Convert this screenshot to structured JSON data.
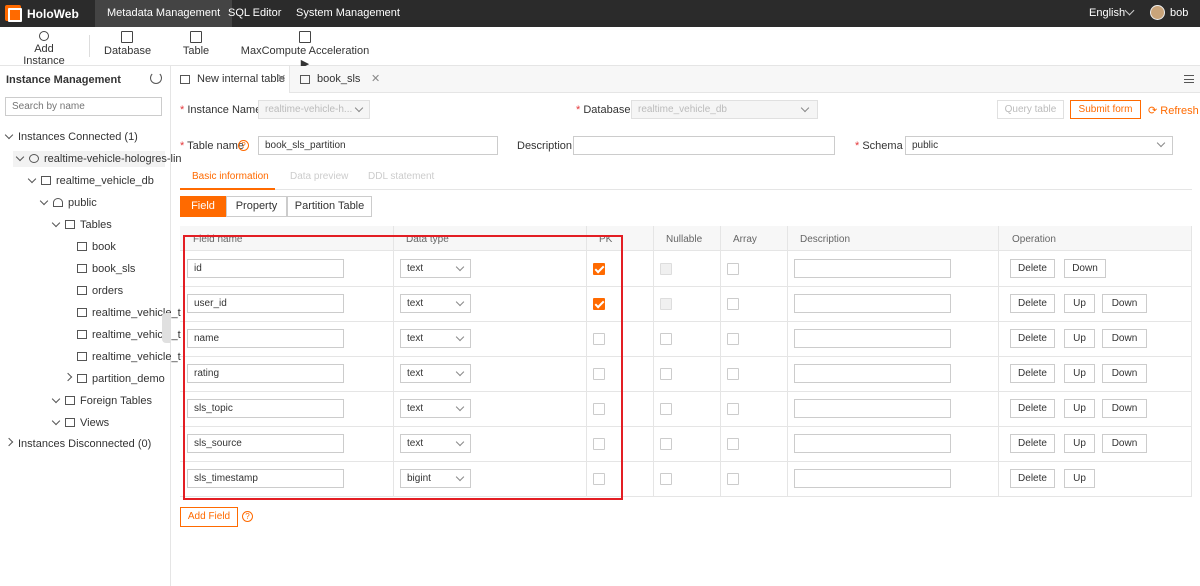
{
  "app": {
    "name": "HoloWeb"
  },
  "nav": [
    "Metadata Management",
    "SQL Editor",
    "System Management"
  ],
  "topright": {
    "language": "English",
    "user": "bob"
  },
  "toolbar": {
    "add_instance": "Add Instance",
    "database": "Database",
    "table": "Table",
    "maxcompute": "MaxCompute Acceleration ▶"
  },
  "sidebar": {
    "title": "Instance Management",
    "search_placeholder": "Search by name",
    "connected": "Instances Connected (1)",
    "instance": "realtime-vehicle-hologres-lin",
    "db": "realtime_vehicle_db",
    "schema": "public",
    "tables_label": "Tables",
    "tables": [
      "book",
      "book_sls",
      "orders",
      "realtime_vehicle_t",
      "realtime_vehicle_t",
      "realtime_vehicle_t",
      "partition_demo"
    ],
    "foreign": "Foreign Tables",
    "views": "Views",
    "disconnected": "Instances Disconnected (0)"
  },
  "tabs": [
    {
      "label": "New internal table"
    },
    {
      "label": "book_sls"
    }
  ],
  "form": {
    "instance_label": "Instance Name",
    "instance_value": "realtime-vehicle-h...",
    "database_label": "Database",
    "database_value": "realtime_vehicle_db",
    "query_btn": "Query table",
    "submit_btn": "Submit form",
    "refresh": "Refresh",
    "tablename_label": "Table name",
    "tablename_value": "book_sls_partition",
    "description_label": "Description",
    "schema_label": "Schema",
    "schema_value": "public"
  },
  "subtabs": [
    "Basic information",
    "Data preview",
    "DDL statement"
  ],
  "segments": [
    "Field",
    "Property",
    "Partition Table"
  ],
  "columns": [
    "Field name",
    "Data type",
    "PK",
    "Nullable",
    "Array",
    "Description",
    "Operation"
  ],
  "ops": {
    "delete": "Delete",
    "up": "Up",
    "down": "Down"
  },
  "fields": [
    {
      "name": "id",
      "type": "text",
      "pk": true
    },
    {
      "name": "user_id",
      "type": "text",
      "pk": true
    },
    {
      "name": "name",
      "type": "text",
      "pk": false
    },
    {
      "name": "rating",
      "type": "text",
      "pk": false
    },
    {
      "name": "sls_topic",
      "type": "text",
      "pk": false
    },
    {
      "name": "sls_source",
      "type": "text",
      "pk": false
    },
    {
      "name": "sls_timestamp",
      "type": "bigint",
      "pk": false
    }
  ],
  "add_field": "Add Field",
  "colors": {
    "accent": "#ff6a00",
    "highlight": "#e31e24",
    "topbar": "#2b2b2b"
  }
}
